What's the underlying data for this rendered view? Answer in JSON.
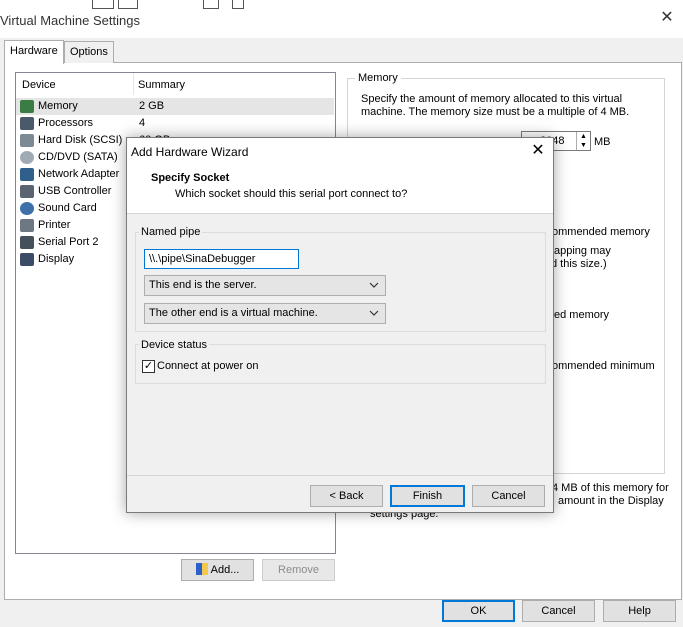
{
  "window": {
    "title": "Virtual Machine Settings"
  },
  "tabs": [
    {
      "label": "Hardware"
    },
    {
      "label": "Options"
    }
  ],
  "device_list": {
    "col_device": "Device",
    "col_summary": "Summary",
    "items": [
      {
        "name": "Memory",
        "summary": "2 GB"
      },
      {
        "name": "Processors",
        "summary": "4"
      },
      {
        "name": "Hard Disk (SCSI)",
        "summary": "60 GB"
      },
      {
        "name": "CD/DVD (SATA)",
        "summary": ""
      },
      {
        "name": "Network Adapter",
        "summary": ""
      },
      {
        "name": "USB Controller",
        "summary": ""
      },
      {
        "name": "Sound Card",
        "summary": ""
      },
      {
        "name": "Printer",
        "summary": ""
      },
      {
        "name": "Serial Port 2",
        "summary": ""
      },
      {
        "name": "Display",
        "summary": ""
      }
    ]
  },
  "memory_panel": {
    "title": "Memory",
    "desc_line1": "Specify the amount of memory allocated to this virtual",
    "desc_line2": "machine. The memory size must be a multiple of 4 MB.",
    "value": "2048",
    "unit": "MB",
    "partial_recommended": "ommended memory",
    "partial_swapping1": "apping may",
    "partial_swapping2": "d this size.)",
    "partial_guest": "ed memory",
    "partial_min": "ommended minimum",
    "partial_bottom1": "4 MB of this memory for",
    "partial_bottom2": "amount in the Display",
    "partial_bottom3": "settings page."
  },
  "device_buttons": {
    "add": "Add...",
    "remove": "Remove"
  },
  "footer_buttons": {
    "ok": "OK",
    "cancel": "Cancel",
    "help": "Help"
  },
  "wizard": {
    "title": "Add Hardware Wizard",
    "heading": "Specify Socket",
    "subheading": "Which socket should this serial port connect to?",
    "named_pipe_label": "Named pipe",
    "pipe_value": "\\\\.\\pipe\\SinaDebugger",
    "end_option": "This end is the server.",
    "other_end_option": "The other end is a virtual machine.",
    "device_status_label": "Device status",
    "connect_label": "Connect at power on",
    "connect_checked": true,
    "back": "< Back",
    "finish": "Finish",
    "cancel": "Cancel"
  },
  "colors": {
    "accent": "#0078d7",
    "selection": "#e5e5e5",
    "dialog_bg": "#f0f0f0"
  }
}
